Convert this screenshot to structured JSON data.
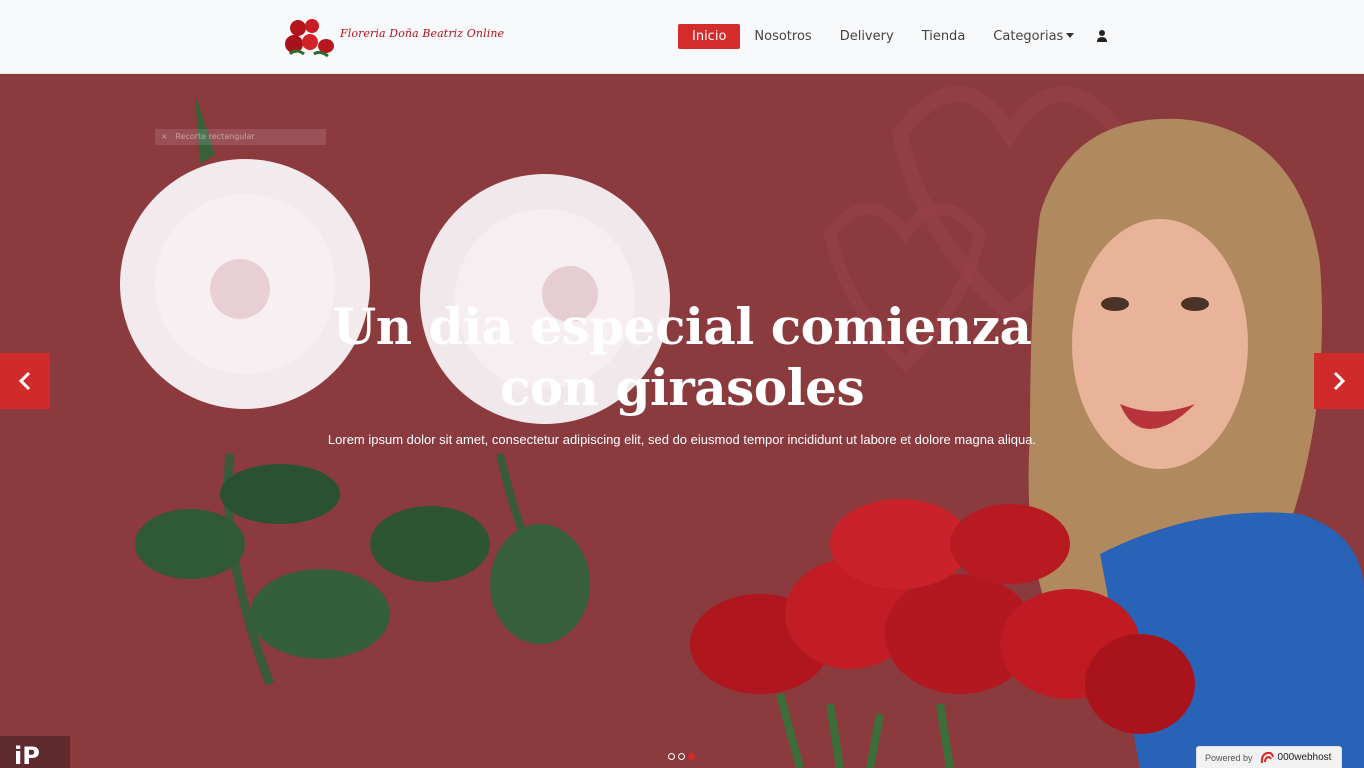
{
  "brand": {
    "name": "Floreria Doña Beatriz Online"
  },
  "nav": {
    "items": [
      {
        "label": "Inicio",
        "active": true
      },
      {
        "label": "Nosotros",
        "active": false
      },
      {
        "label": "Delivery",
        "active": false
      },
      {
        "label": "Tienda",
        "active": false
      },
      {
        "label": "Categorias",
        "active": false,
        "dropdown": true
      }
    ],
    "user_icon": "user-icon"
  },
  "hero": {
    "overlay_label": "Recorte rectangular",
    "title": "Un dia especial comienza con girasoles",
    "text": "Lorem ipsum dolor sit amet, consectetur adipiscing elit, sed do eiusmod tempor incididunt ut labore et dolore magna aliqua.",
    "prev_icon": "chevron-left-icon",
    "next_icon": "chevron-right-icon",
    "slides": 3,
    "active_slide": 3,
    "corner_text": "iP"
  },
  "footer_badge": {
    "prefix": "Powered by",
    "name": "000webhost"
  },
  "colors": {
    "accent": "#d42b2b",
    "hero_bg": "#8b3a3e",
    "navbar_bg": "#f8f9fa"
  }
}
